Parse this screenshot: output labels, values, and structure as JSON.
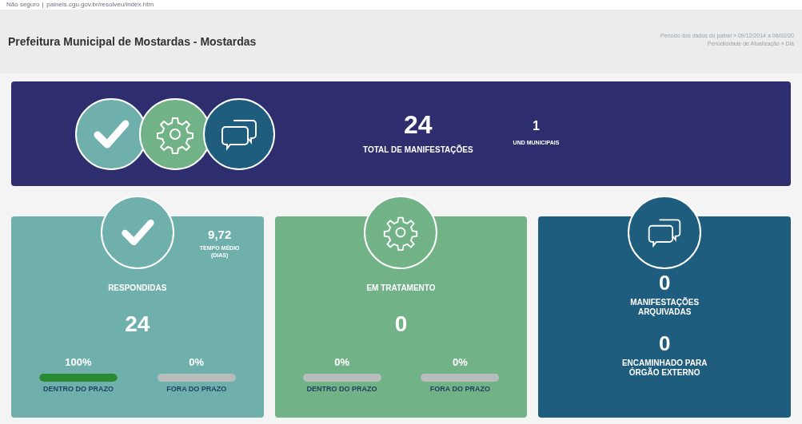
{
  "browser": {
    "security": "Não seguro",
    "url": "paineis.cgu.gov.br/resolveu/index.htm"
  },
  "header": {
    "title": "Prefeitura Municipal de Mostardas - Mostardas",
    "period": "Período dos dados do painel » 09/12/2014 a 06/02/20",
    "frequency": "Periodicidade de Atualização » Diá"
  },
  "banner": {
    "total": "24",
    "total_label": "TOTAL DE MANIFESTAÇÕES",
    "units": "1",
    "units_label": "UND MUNICIPAIS"
  },
  "cards": [
    {
      "kind": "responded",
      "title": "RESPONDIDAS",
      "value": "24",
      "avg_time": "9,72",
      "avg_label": "TEMPO MÉDIO (DIAS)",
      "bars": [
        {
          "percent": "100%",
          "level": 1,
          "label": "DENTRO DO PRAZO"
        },
        {
          "percent": "0%",
          "level": 0,
          "label": "FORA DO PRAZO"
        }
      ]
    },
    {
      "kind": "processing",
      "title": "EM TRATAMENTO",
      "value": "0",
      "bars": [
        {
          "percent": "0%",
          "level": 0,
          "label": "DENTRO DO PRAZO"
        },
        {
          "percent": "0%",
          "level": 0,
          "label": "FORA DO PRAZO"
        }
      ]
    },
    {
      "kind": "archived",
      "stats": [
        {
          "value": "0",
          "label": "MANIFESTAÇÕES ARQUIVADAS"
        },
        {
          "value": "0",
          "label": "ENCAMINHADO PARA ÓRGÃO EXTERNO"
        }
      ]
    }
  ]
}
